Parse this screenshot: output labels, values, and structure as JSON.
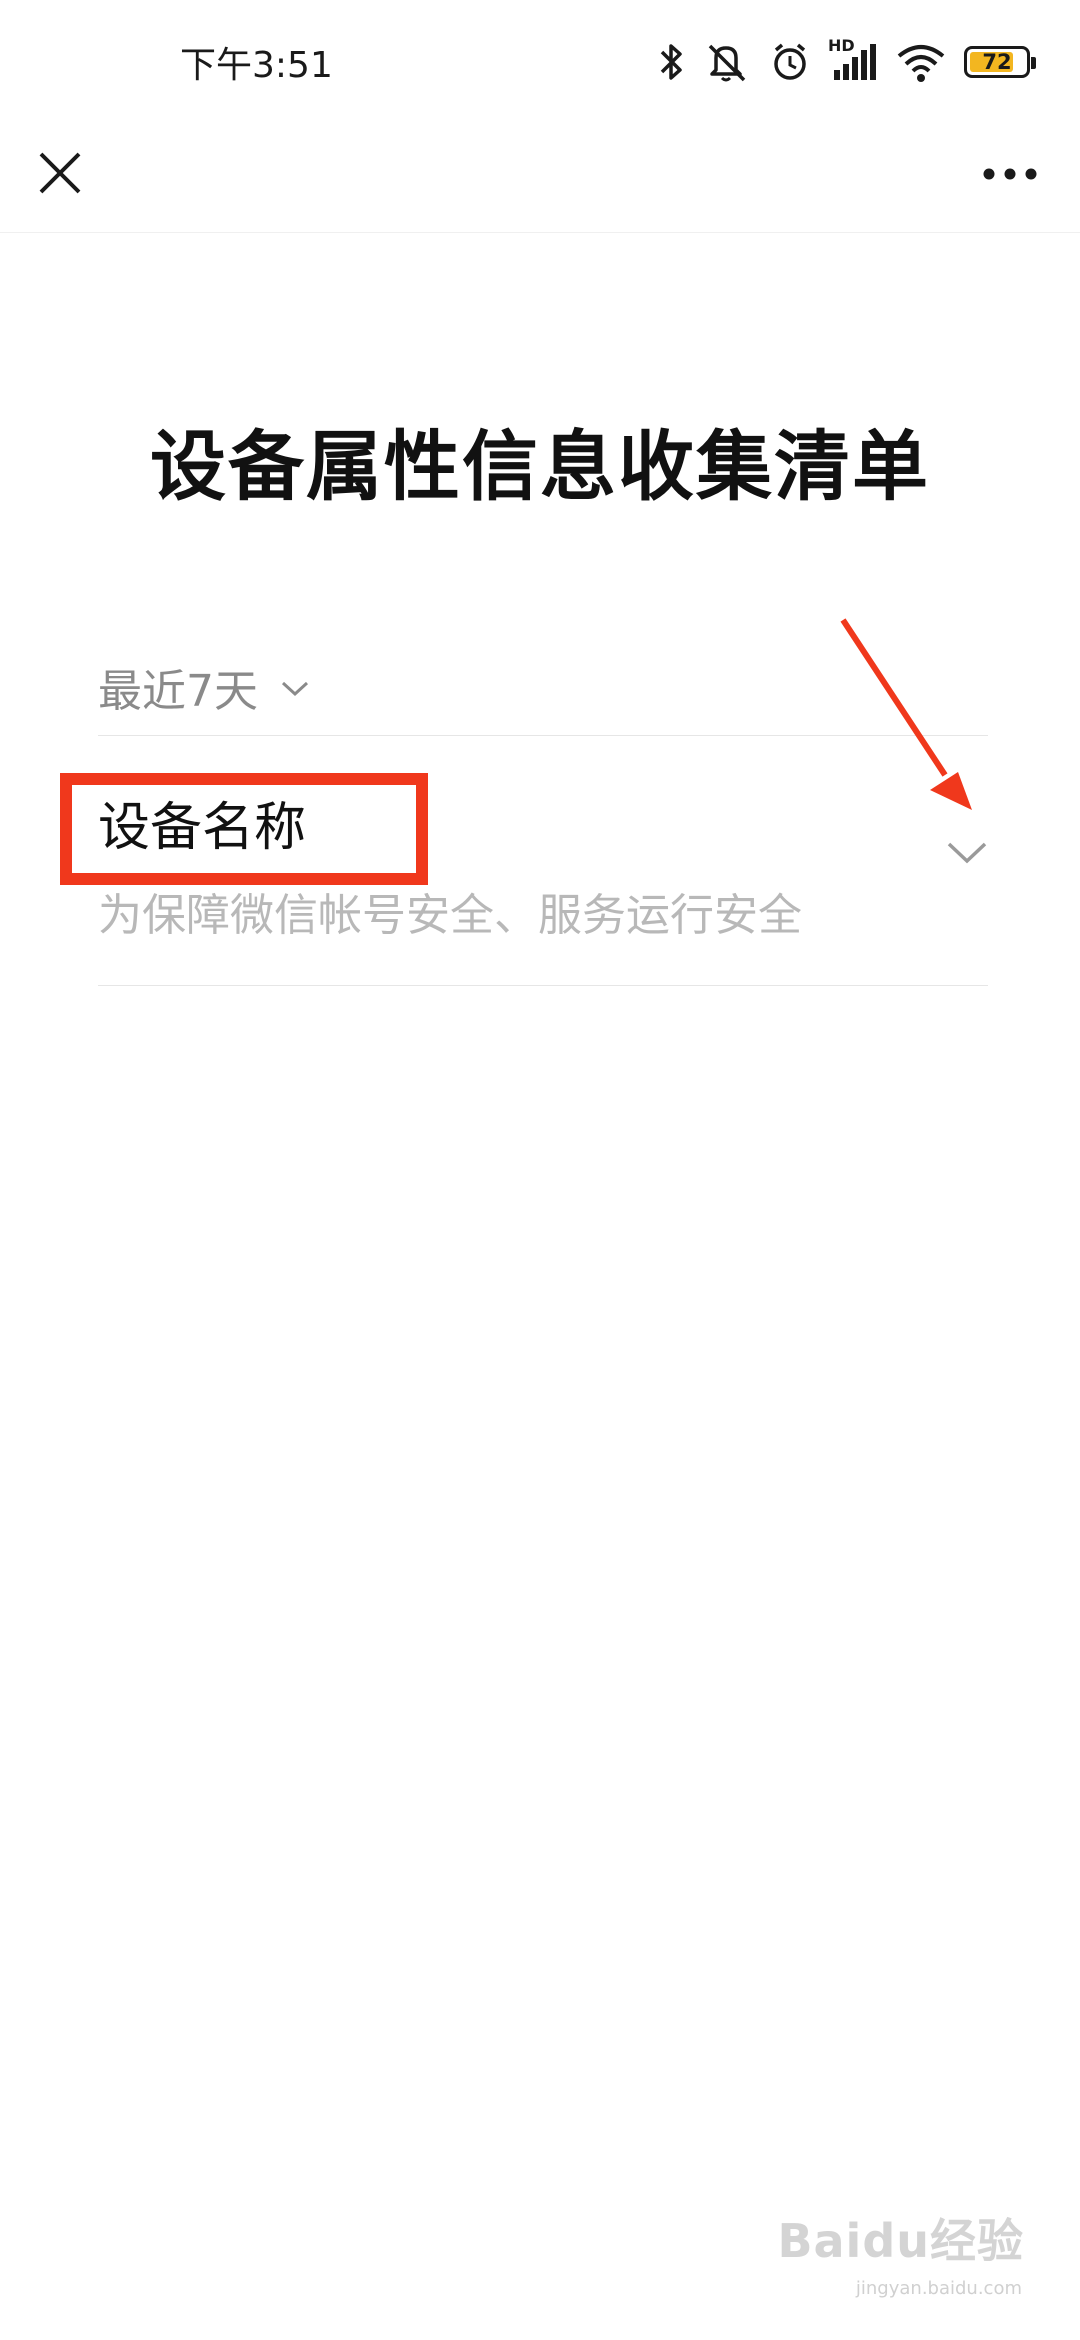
{
  "status_bar": {
    "time": "下午3:51",
    "icons": [
      "bluetooth-icon",
      "mute-icon",
      "alarm-icon",
      "signal-icon",
      "wifi-icon",
      "battery-icon"
    ],
    "network_label": "HD",
    "battery_level": "72"
  },
  "nav": {
    "close_icon": "close-icon",
    "more_icon": "more-icon"
  },
  "page": {
    "title": "设备属性信息收集清单"
  },
  "filter": {
    "label": "最近7天"
  },
  "list": {
    "items": [
      {
        "title": "设备名称",
        "subtitle": "为保障微信帐号安全、服务运行安全"
      }
    ]
  },
  "colors": {
    "highlight": "#f0381c",
    "battery_fill": "#f3b620",
    "muted_text": "#8a8a8a",
    "subtitle_text": "#b8b8b8"
  },
  "watermark": {
    "text": "Baidu经验",
    "sub": "jingyan.baidu.com"
  }
}
